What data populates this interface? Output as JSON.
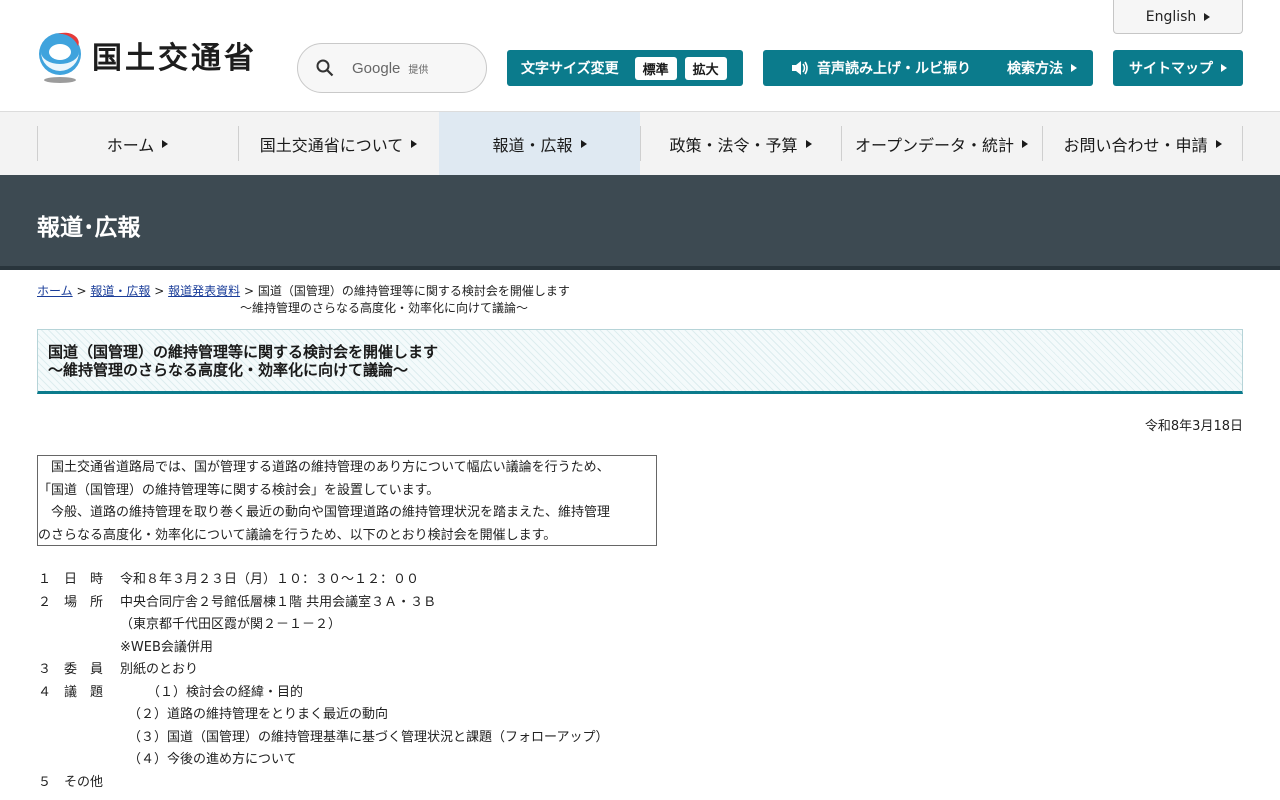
{
  "header": {
    "logo_text": "国土交通省",
    "english_label": "English",
    "search": {
      "brand": "Google",
      "provided": "提供"
    },
    "fontsize": {
      "label": "文字サイズ変更",
      "standard": "標準",
      "large": "拡大"
    },
    "voice_label": "音声読み上げ・ルビ振り",
    "search_method_label": "検索方法",
    "sitemap_label": "サイトマップ"
  },
  "nav": {
    "items": [
      {
        "label": "ホーム"
      },
      {
        "label": "国土交通省について"
      },
      {
        "label": "報道・広報"
      },
      {
        "label": "政策・法令・予算"
      },
      {
        "label": "オープンデータ・統計"
      },
      {
        "label": "お問い合わせ・申請"
      }
    ]
  },
  "section": {
    "title": "報道･広報"
  },
  "breadcrumb": {
    "home": "ホーム",
    "press": "報道・広報",
    "release": "報道発表資料",
    "sep": ">",
    "current": "国道（国管理）の維持管理等に関する検討会を開催します",
    "current_sub": "～維持管理のさらなる高度化・効率化に向けて議論～"
  },
  "page": {
    "title_line1": "国道（国管理）の維持管理等に関する検討会を開催します",
    "title_line2": "～維持管理のさらなる高度化・効率化に向けて議論～",
    "date": "令和8年3月18日"
  },
  "intro": {
    "line1": "　国土交通省道路局では、国が管理する道路の維持管理のあり方について幅広い議論を行うため、",
    "line2": "「国道（国管理）の維持管理等に関する検討会」を設置しています。",
    "line3": "　今般、道路の維持管理を取り巻く最近の動向や国管理道路の維持管理状況を踏まえた、維持管理",
    "line4": "のさらなる高度化・効率化について議論を行うため、以下のとおり検討会を開催します。"
  },
  "details": {
    "item1": {
      "num": "１",
      "label": "日　時",
      "value": "令和８年３月２３日（月）１０：３０～１２：００"
    },
    "item2": {
      "num": "２",
      "label": "場　所",
      "value": "中央合同庁舎２号館低層棟１階 共用会議室３Ａ・３Ｂ",
      "sub1": "（東京都千代田区霞が関２－１－２）",
      "sub2": "※WEB会議併用"
    },
    "item3": {
      "num": "３",
      "label": "委　員",
      "value": "別紙のとおり"
    },
    "item4": {
      "num": "４",
      "label": "議　題",
      "value": "（１）検討会の経緯・目的",
      "sub1": "（２）道路の維持管理をとりまく最近の動向",
      "sub2": "（３）国道（国管理）の維持管理基準に基づく管理状況と課題（フォローアップ）",
      "sub3": "（４）今後の進め方について"
    },
    "item5": {
      "num": "５",
      "label": "その他"
    }
  }
}
